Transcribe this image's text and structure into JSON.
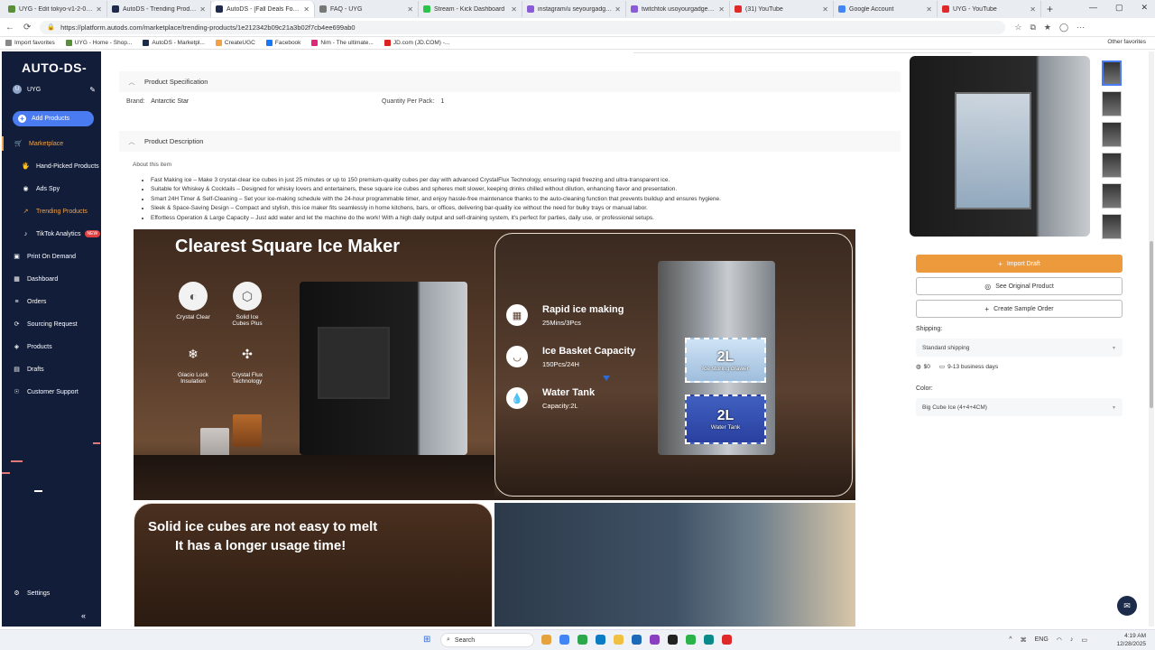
{
  "browser": {
    "tabs": [
      {
        "label": "UYG - Edit tokyo-v1-2-0 · Shopify",
        "color": "#5a8f3a"
      },
      {
        "label": "AutoDS - Trending Products",
        "color": "#1d2a4a"
      },
      {
        "label": "AutoDS - [Fall Deals For You] Ant",
        "color": "#1d2a4a",
        "active": true
      },
      {
        "label": "FAQ - UYG",
        "color": "#777"
      },
      {
        "label": "Stream - Kick Dashboard",
        "color": "#2bc44b"
      },
      {
        "label": "instagram/u seyourgadgets.store",
        "color": "#8a5bd6"
      },
      {
        "label": "twitchtok usoyourgadgets.store",
        "color": "#8a5bd6"
      },
      {
        "label": "(31) YouTube",
        "color": "#e02828"
      },
      {
        "label": "Google Account",
        "color": "#4285f4"
      },
      {
        "label": "UYG - YouTube",
        "color": "#e02828"
      }
    ],
    "url": "https://platform.autods.com/marketplace/trending-products/1e212342b09c21a3b02f7cb4ee699ab0",
    "bookmarks": [
      "Import favorites",
      "UYG - Home - Shop...",
      "AutoDS - Marketpl...",
      "CreateUGC",
      "Facebook",
      "Nim - The ultimate...",
      "JD.com (JD.COM) -..."
    ],
    "bookmark_colors": [
      "#888",
      "#5a8f3a",
      "#1d2a4a",
      "#f0a24a",
      "#1877f2",
      "#e02878",
      "#d22"
    ],
    "other_favorites": "Other favorites"
  },
  "sidebar": {
    "logo": "AUTO-DS-",
    "user": {
      "initial": "U",
      "name": "UYG"
    },
    "add_products": "Add Products",
    "nav": [
      {
        "label": "Marketplace",
        "icon": "🛒",
        "sub": false,
        "orange": true,
        "active": true
      },
      {
        "label": "Hand-Picked Products",
        "icon": "🖐",
        "sub": true
      },
      {
        "label": "Ads Spy",
        "icon": "◉",
        "sub": true
      },
      {
        "label": "Trending Products",
        "icon": "↗",
        "sub": true,
        "orange": true
      },
      {
        "label": "TikTok Analytics",
        "icon": "♪",
        "sub": true,
        "badge": "NEW"
      },
      {
        "label": "Print On Demand",
        "icon": "▣",
        "sub": false
      },
      {
        "label": "Dashboard",
        "icon": "▦",
        "sub": false
      },
      {
        "label": "Orders",
        "icon": "≡",
        "sub": false
      },
      {
        "label": "Sourcing Request",
        "icon": "⟳",
        "sub": false
      },
      {
        "label": "Products",
        "icon": "◈",
        "sub": false
      },
      {
        "label": "Drafts",
        "icon": "▤",
        "sub": false
      },
      {
        "label": "Customer Support",
        "icon": "☉",
        "sub": false
      }
    ],
    "settings": "Settings"
  },
  "spec": {
    "header": "Product Specification",
    "brand_label": "Brand:",
    "brand_value": "Antarctic Star",
    "qty_label": "Quantity Per Pack:",
    "qty_value": "1"
  },
  "description": {
    "header": "Product Description",
    "about": "About this item",
    "bullets": [
      "Fast Making ice – Make 3 crystal-clear ice cubes in just 25 minutes or up to 150 premium-quality cubes per day with advanced CrystalFlux Technology, ensuring rapid freezing and ultra-transparent ice.",
      "Suitable for Whiskey & Cocktails – Designed for whisky lovers and entertainers, these square ice cubes and spheres melt slower, keeping drinks chilled without dilution, enhancing flavor and presentation.",
      "Smart 24H Timer & Self-Cleaning – Set your ice-making schedule with the 24-hour programmable timer, and enjoy hassle-free maintenance thanks to the auto-cleaning function that prevents buildup and ensures hygiene.",
      "Sleek & Space-Saving Design – Compact and stylish, this ice maker fits seamlessly in home kitchens, bars, or offices, delivering bar-quality ice without the need for bulky trays or manual labor.",
      "Effortless Operation & Large Capacity – Just add water and let the machine do the work! With a high daily output and self-draining system, it's perfect for parties, daily use, or professional setups."
    ],
    "banner1": {
      "title": "Clearest Square Ice Maker",
      "features": [
        {
          "label": "Crystal Clear",
          "icon": "◐"
        },
        {
          "label": "Solid Ice\nCubes Plus",
          "icon": "⬡"
        },
        {
          "label": "Glacio Lock\nInsulation",
          "icon": "❄"
        },
        {
          "label": "Crystal Flux\nTechnology",
          "icon": "✣"
        }
      ],
      "right_features": [
        {
          "title": "Rapid ice making",
          "sub": "25Mins/3Pcs",
          "icon": "▦"
        },
        {
          "title": "Ice Basket Capacity",
          "sub": "150Pcs/24H",
          "icon": "◡"
        },
        {
          "title": "Water Tank",
          "sub": "Capacity:2L",
          "icon": "💧"
        }
      ],
      "drawer_big": "2L",
      "drawer_label": "Ice storing drawer",
      "tank_big": "2L",
      "tank_label": "Water Tank"
    },
    "banner2": {
      "line1": "Solid ice cubes are not easy to melt",
      "line2": "It has a longer usage time!"
    }
  },
  "right": {
    "import_draft": "Import Draft",
    "see_original": "See Original Product",
    "create_sample": "Create Sample Order",
    "shipping_label": "Shipping:",
    "shipping_value": "Standard shipping",
    "price": "$0",
    "days": "9-13 business days",
    "color_label": "Color:",
    "color_value": "Big Cube Ice (4+4+4CM)"
  },
  "taskbar": {
    "search": "Search",
    "lang": "ENG",
    "time": "4:19 AM",
    "date": "12/28/2025",
    "app_colors": [
      "#e6a23c",
      "#4285f4",
      "#2aa84a",
      "#0a7cc4",
      "#f0c040",
      "#1c6ab8",
      "#8a3fc0",
      "#222",
      "#2bb34a",
      "#0a8a8a",
      "#e02828"
    ]
  }
}
